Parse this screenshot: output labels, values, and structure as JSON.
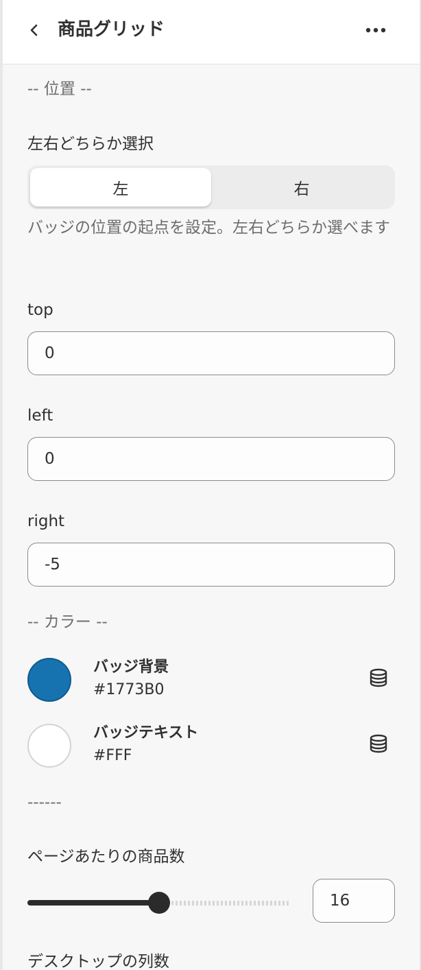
{
  "header": {
    "title": "商品グリッド"
  },
  "position_section": {
    "label": "-- 位置 --",
    "side_select": {
      "label": "左右どちらか選択",
      "options": [
        "左",
        "右"
      ],
      "selected": "左",
      "help": "バッジの位置の起点を設定。左右どちらか選べます"
    },
    "top": {
      "label": "top",
      "value": "0"
    },
    "left": {
      "label": "left",
      "value": "0"
    },
    "right": {
      "label": "right",
      "value": "-5"
    }
  },
  "color_section": {
    "label": "-- カラー --",
    "badge_bg": {
      "name": "バッジ背景",
      "value": "#1773B0",
      "swatch": "#1773B0"
    },
    "badge_text": {
      "name": "バッジテキスト",
      "value": "#FFF",
      "swatch": "#FFFFFF"
    }
  },
  "divider_label": "------",
  "products_per_page": {
    "label": "ページあたりの商品数",
    "value": "16",
    "slider_fraction": 0.5
  },
  "desktop_columns": {
    "label": "デスクトップの列数"
  },
  "icons": {
    "back": "chevron-left-icon",
    "more": "more-horizontal-icon",
    "database": "database-icon"
  }
}
